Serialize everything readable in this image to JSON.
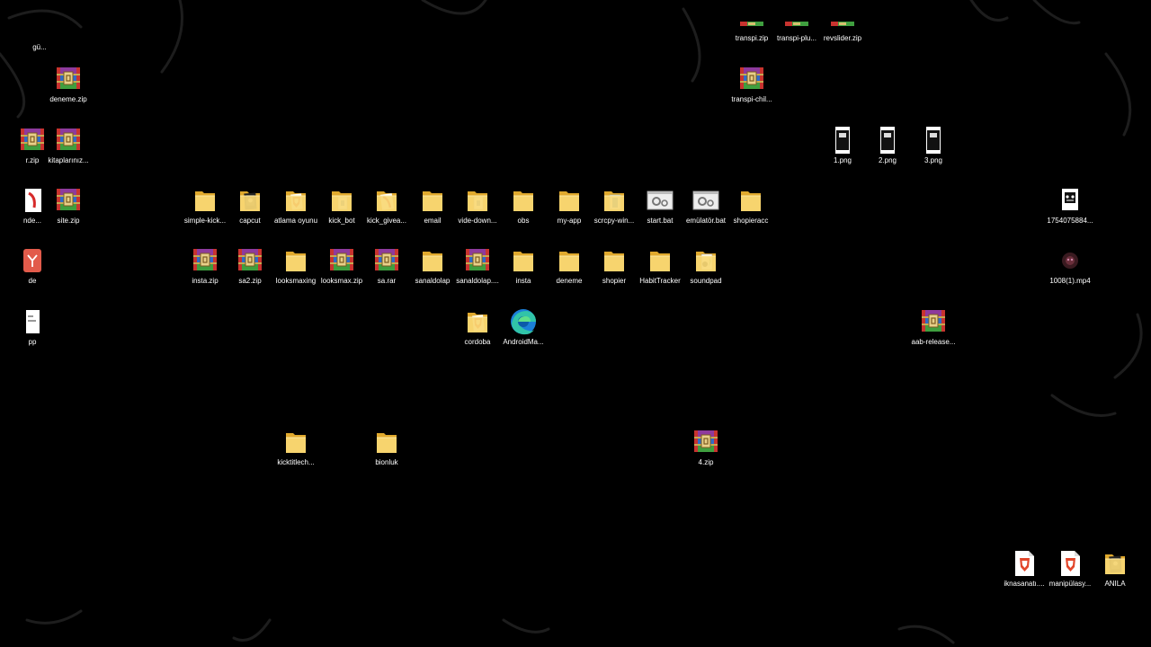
{
  "desktop": {
    "icons": [
      {
        "id": "partial-gu",
        "label": "gü...",
        "type": "none"
      },
      {
        "id": "transpi-zip",
        "label": "transpi.zip",
        "type": "zip-partial"
      },
      {
        "id": "transpi-plu",
        "label": "transpi-plu...",
        "type": "zip-partial"
      },
      {
        "id": "revslider-zip",
        "label": "revslider.zip",
        "type": "zip-partial"
      },
      {
        "id": "deneme-zip",
        "label": "deneme.zip",
        "type": "zip"
      },
      {
        "id": "transpi-chil",
        "label": "transpi-chil...",
        "type": "zip"
      },
      {
        "id": "partial-r-zip",
        "label": "r.zip",
        "type": "zip"
      },
      {
        "id": "kitaplariniz",
        "label": "kitaplarınız...",
        "type": "zip"
      },
      {
        "id": "png-1",
        "label": "1.png",
        "type": "phone"
      },
      {
        "id": "png-2",
        "label": "2.png",
        "type": "phone"
      },
      {
        "id": "png-3",
        "label": "3.png",
        "type": "phone"
      },
      {
        "id": "partial-nde",
        "label": "nde...",
        "type": "pdf"
      },
      {
        "id": "site-zip",
        "label": "site.zip",
        "type": "zip"
      },
      {
        "id": "simple-kick",
        "label": "simple-kick...",
        "type": "folder"
      },
      {
        "id": "capcut",
        "label": "capcut",
        "type": "folder-dark"
      },
      {
        "id": "atlama-oyunu",
        "label": "atlama oyunu",
        "type": "folder-brave"
      },
      {
        "id": "kick-bot",
        "label": "kick_bot",
        "type": "folder-file"
      },
      {
        "id": "kick-givea",
        "label": "kick_givea...",
        "type": "folder-red"
      },
      {
        "id": "email",
        "label": "email",
        "type": "folder"
      },
      {
        "id": "vide-down",
        "label": "vide-down...",
        "type": "folder-file"
      },
      {
        "id": "obs",
        "label": "obs",
        "type": "folder"
      },
      {
        "id": "my-app",
        "label": "my-app",
        "type": "folder"
      },
      {
        "id": "scrcpy-win",
        "label": "scrcpy-win...",
        "type": "folder-blue"
      },
      {
        "id": "start-bat",
        "label": "start.bat",
        "type": "bat"
      },
      {
        "id": "emulator-bat",
        "label": "emülatör.bat",
        "type": "bat"
      },
      {
        "id": "shopieracc",
        "label": "shopieracc",
        "type": "folder"
      },
      {
        "id": "file-1754075884",
        "label": "1754075884...",
        "type": "mask"
      },
      {
        "id": "partial-de",
        "label": "de",
        "type": "app-red"
      },
      {
        "id": "insta-zip",
        "label": "insta.zip",
        "type": "zip"
      },
      {
        "id": "sa2-zip",
        "label": "sa2.zip",
        "type": "zip"
      },
      {
        "id": "looksmaxing",
        "label": "looksmaxing",
        "type": "folder"
      },
      {
        "id": "looksmax-zip",
        "label": "looksmax.zip",
        "type": "zip"
      },
      {
        "id": "sa-rar",
        "label": "sa.rar",
        "type": "zip"
      },
      {
        "id": "sanaldolap",
        "label": "sanaldolap",
        "type": "folder"
      },
      {
        "id": "sanaldolap-2",
        "label": "sanaldolap....",
        "type": "zip"
      },
      {
        "id": "insta",
        "label": "insta",
        "type": "folder"
      },
      {
        "id": "deneme",
        "label": "deneme",
        "type": "folder"
      },
      {
        "id": "shopier",
        "label": "shopier",
        "type": "folder"
      },
      {
        "id": "habittracker",
        "label": "HabitTracker",
        "type": "folder"
      },
      {
        "id": "soundpad",
        "label": "soundpad",
        "type": "folder-green"
      },
      {
        "id": "mp4-1008",
        "label": "1008(1).mp4",
        "type": "video"
      },
      {
        "id": "partial-pp",
        "label": "pp",
        "type": "doc"
      },
      {
        "id": "cordoba",
        "label": "cordoba",
        "type": "folder-brave"
      },
      {
        "id": "androidma",
        "label": "AndroidMa...",
        "type": "edge"
      },
      {
        "id": "aab-release",
        "label": "aab-release...",
        "type": "zip"
      },
      {
        "id": "kicktitlech",
        "label": "kicktitlech...",
        "type": "folder"
      },
      {
        "id": "bionluk",
        "label": "bionluk",
        "type": "folder"
      },
      {
        "id": "zip-4",
        "label": "4.zip",
        "type": "zip"
      },
      {
        "id": "iknasanati",
        "label": "iknasanatı....",
        "type": "brave-doc"
      },
      {
        "id": "manipulasy",
        "label": "manipülasy...",
        "type": "brave-doc"
      },
      {
        "id": "anila",
        "label": "ANILA",
        "type": "folder-dark"
      }
    ]
  },
  "colors": {
    "background": "#000000",
    "label_text": "#ffffff",
    "folder": "#f2c94c",
    "zip_purple": "#8e3a9d",
    "zip_blue": "#2f6cc8",
    "zip_green": "#3f9f3f",
    "zip_red": "#c8332f"
  }
}
